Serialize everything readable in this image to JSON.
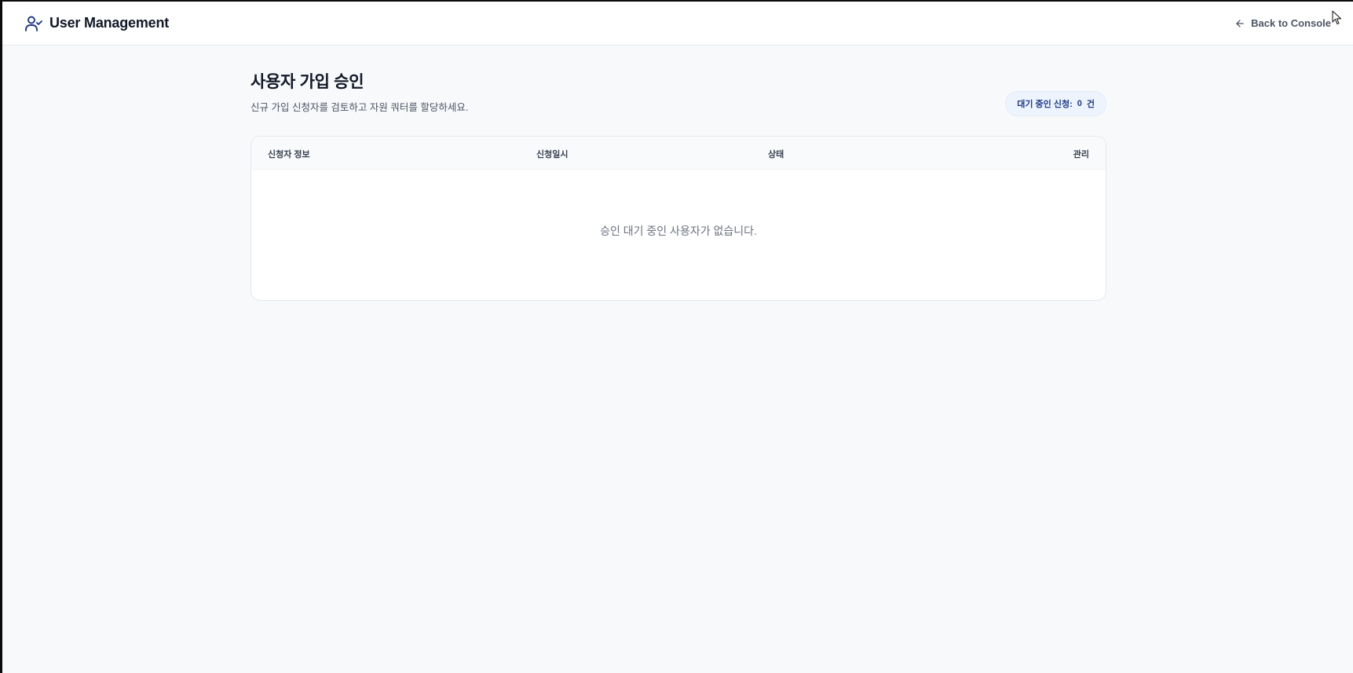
{
  "app": {
    "title": "User Management",
    "back_label": "Back to Console",
    "brand_icon": "user-check-icon",
    "back_icon": "arrow-left-icon"
  },
  "page": {
    "title": "사용자 가입 승인",
    "subtitle": "신규 가입 신청자를 검토하고 자원 쿼터를 할당하세요.",
    "pending": {
      "label": "대기 중인 신청:",
      "count": "0",
      "unit": "건"
    }
  },
  "table": {
    "columns": [
      "신청자 정보",
      "신청일시",
      "상태",
      "관리"
    ],
    "empty_message": "승인 대기 중인 사용자가 없습니다.",
    "rows": []
  },
  "colors": {
    "background": "#f8f9fb",
    "accent": "#1e3a8a",
    "badge_bg": "#eef4fd"
  }
}
